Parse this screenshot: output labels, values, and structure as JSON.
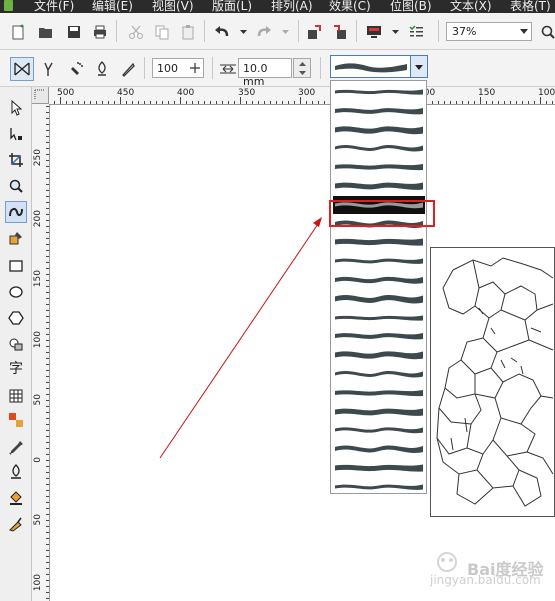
{
  "menubar": {
    "items": [
      "文件(F)",
      "编辑(E)",
      "视图(V)",
      "版面(L)",
      "排列(A)",
      "效果(C)",
      "位图(B)",
      "文本(X)",
      "表格(T)"
    ]
  },
  "toolbar": {
    "zoom_value": "37%"
  },
  "property_bar": {
    "smoothness_value": "100",
    "width_value": "10.0 mm"
  },
  "ruler_h": {
    "labels": [
      "500",
      "450",
      "400",
      "350",
      "300",
      "200",
      "150",
      "100"
    ]
  },
  "ruler_v": {
    "labels": [
      "250",
      "200",
      "150",
      "100",
      "50",
      "0",
      "50",
      "100"
    ]
  },
  "toolbox": {
    "text_tool_glyph": "字"
  },
  "colors": {
    "accent_highlight": "#e02020",
    "arrow": "#cc1111",
    "selection_border": "#4a7ab8",
    "stroke": "#3c4a4e",
    "menubar_bg": "#2b2b2b"
  },
  "watermark": {
    "text": "Bai度经验",
    "url": "jingyan.baidu.com"
  }
}
